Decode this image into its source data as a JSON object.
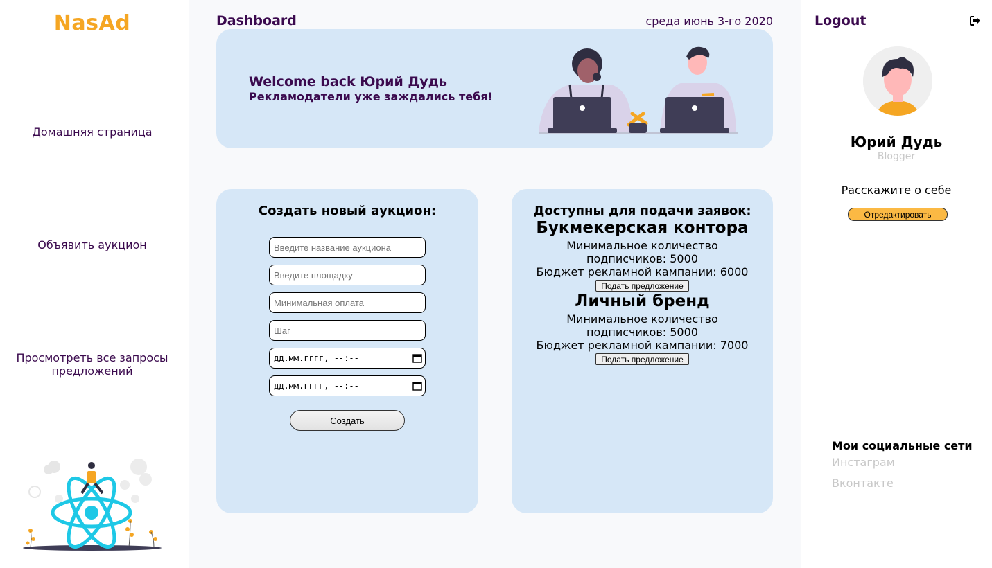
{
  "sidebar": {
    "logo": "NasAd",
    "items": [
      {
        "label": "Домашняя страница"
      },
      {
        "label": "Объявить аукцион"
      },
      {
        "label": "Просмотреть все запросы предложений"
      }
    ]
  },
  "header": {
    "title": "Dashboard",
    "date": "среда июнь 3-го 2020"
  },
  "welcome": {
    "title": "Welcome back Юрий Дудь",
    "subtitle": "Рекламодатели уже заждались тебя!"
  },
  "create_form": {
    "title": "Создать новый аукцион:",
    "fields": [
      {
        "placeholder": "Введите название аукциона"
      },
      {
        "placeholder": "Введите площадку"
      },
      {
        "placeholder": "Минимальная оплата"
      },
      {
        "placeholder": "Шаг"
      }
    ],
    "date_fields": [
      {
        "value": "дд.мм.гггг, --:--"
      },
      {
        "value": "дд.мм.гггг, --:--"
      }
    ],
    "submit_label": "Создать"
  },
  "available": {
    "title": "Доступны для подачи заявок:",
    "auctions": [
      {
        "name": "Букмекерская контора",
        "min_subscribers_line1": "Минимальное количество",
        "min_subscribers_line2": "подписчиков: 5000",
        "budget": "Бюджет рекламной кампании: 6000",
        "button": "Подать предложение"
      },
      {
        "name": "Личный бренд",
        "min_subscribers_line1": "Минимальное количество",
        "min_subscribers_line2": "подписчиков: 5000",
        "budget": "Бюджет рекламной кампании: 7000",
        "button": "Подать предложение"
      }
    ]
  },
  "profile": {
    "logout": "Logout",
    "name": "Юрий Дудь",
    "role": "Blogger",
    "about": "Расскажите о себе",
    "edit_button": "Отредактировать",
    "socials_title": "Мои социальные сети",
    "socials": [
      "Инстаграм",
      "Вконтакте"
    ]
  },
  "colors": {
    "accent": "#f5a623",
    "text_dark": "#3b0a4e",
    "card_bg": "#d6e7f7",
    "main_bg": "#f8f9fb",
    "edit_button": "#fbb944",
    "react_blue": "#1ec8e6"
  }
}
